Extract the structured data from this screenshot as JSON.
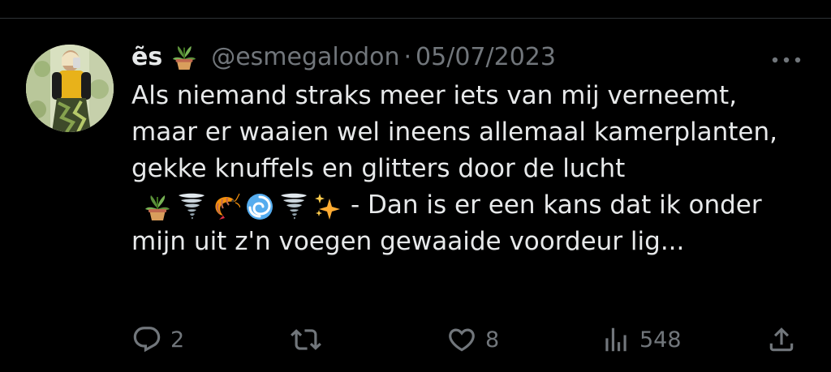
{
  "tweet": {
    "display_name": "ẽs",
    "name_emoji": "potted-plant",
    "handle": "@esmegalodon",
    "separator": "·",
    "date": "05/07/2023",
    "text_part1": "Als niemand straks meer iets van mij verneemt, maar er waaien wel ineens allemaal kamerplanten, gekke knuffels en glitters door de lucht",
    "text_emojis": [
      "potted-plant",
      "tornado",
      "shrimp",
      "cyclone",
      "tornado",
      "sparkles"
    ],
    "text_part2": "- Dan is er een kans dat ik onder mijn uit z'n voegen gewaaide voordeur lig...",
    "stats": {
      "replies": "2",
      "reposts": "",
      "likes": "8",
      "views": "548"
    }
  },
  "colors": {
    "background": "#000000",
    "text": "#e7e9ea",
    "muted": "#71767b",
    "divider": "#2f3336"
  },
  "icons": {
    "more": "more-icon",
    "reply": "reply-icon",
    "retweet": "retweet-icon",
    "like": "heart-icon",
    "views": "views-icon",
    "share": "share-icon"
  }
}
